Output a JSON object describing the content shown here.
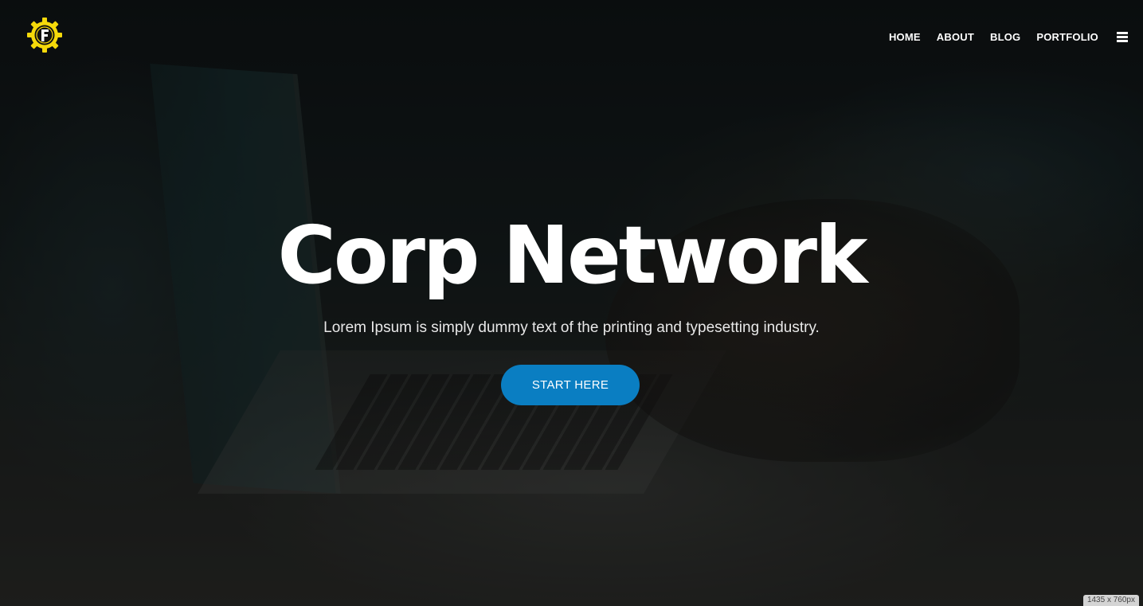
{
  "header": {
    "logo_icon": "gear-f-logo-icon",
    "nav": [
      {
        "label": "HOME"
      },
      {
        "label": "ABOUT"
      },
      {
        "label": "BLOG"
      },
      {
        "label": "PORTFOLIO"
      }
    ],
    "menu_icon": "hamburger-menu-icon"
  },
  "hero": {
    "title": "Corp Network",
    "subtitle": "Lorem Ipsum is simply dummy text of the printing and typesetting industry.",
    "cta_label": "START HERE"
  },
  "viewport_badge": "1435 x 760px",
  "colors": {
    "accent": "#0a7ec2",
    "logo_yellow": "#f5d90a",
    "text": "#ffffff"
  }
}
